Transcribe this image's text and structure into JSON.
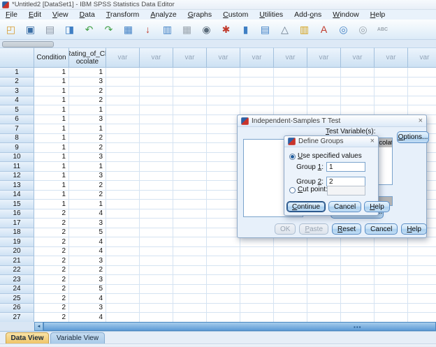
{
  "window": {
    "title": "*Untitled2 [DataSet1] - IBM SPSS Statistics Data Editor"
  },
  "icons": {
    "close_glyph": "×",
    "scroll_left_glyph": "◄",
    "scroll_dots_glyph": "▪▪▪"
  },
  "menubar": {
    "items": [
      {
        "label": "File",
        "u": "F"
      },
      {
        "label": "Edit",
        "u": "E"
      },
      {
        "label": "View",
        "u": "V"
      },
      {
        "label": "Data",
        "u": "D"
      },
      {
        "label": "Transform",
        "u": "T"
      },
      {
        "label": "Analyze",
        "u": "A"
      },
      {
        "label": "Graphs",
        "u": "G"
      },
      {
        "label": "Custom",
        "u": "C"
      },
      {
        "label": "Utilities",
        "u": "U"
      },
      {
        "label": "Add-ons",
        "u": "o"
      },
      {
        "label": "Window",
        "u": "W"
      },
      {
        "label": "Help",
        "u": "H"
      }
    ]
  },
  "toolbar": {
    "icons": [
      {
        "name": "open-data-icon",
        "glyph": "◰",
        "color": "#d79b2f"
      },
      {
        "name": "save-icon",
        "glyph": "▣",
        "color": "#3a6ea5"
      },
      {
        "name": "print-icon",
        "glyph": "▤",
        "color": "#8a94a3"
      },
      {
        "name": "dialog-recall-icon",
        "glyph": "◨",
        "color": "#3f7fc4"
      },
      {
        "name": "undo-icon",
        "glyph": "↶",
        "color": "#43a047"
      },
      {
        "name": "redo-icon",
        "glyph": "↷",
        "color": "#43a047"
      },
      {
        "name": "goto-case-icon",
        "glyph": "▦",
        "color": "#3f7fc4"
      },
      {
        "name": "goto-variable-icon",
        "glyph": "↓",
        "color": "#c0392b"
      },
      {
        "name": "variables-icon",
        "glyph": "▥",
        "color": "#3f7fc4"
      },
      {
        "name": "variables-info-icon",
        "glyph": "▦",
        "color": "#9aa4ad"
      },
      {
        "name": "find-icon",
        "glyph": "◉",
        "color": "#5a6b7a"
      },
      {
        "name": "insert-cases-icon",
        "glyph": "✱",
        "color": "#c0392b"
      },
      {
        "name": "insert-variable-icon",
        "glyph": "▮",
        "color": "#3f7fc4"
      },
      {
        "name": "split-file-icon",
        "glyph": "▤",
        "color": "#3f7fc4"
      },
      {
        "name": "weight-cases-icon",
        "glyph": "△",
        "color": "#6b7c8d"
      },
      {
        "name": "select-cases-icon",
        "glyph": "▥",
        "color": "#d4a017"
      },
      {
        "name": "value-labels-icon",
        "glyph": "A",
        "color": "#c0392b"
      },
      {
        "name": "use-variable-sets-icon",
        "glyph": "◎",
        "color": "#3f7fc4"
      },
      {
        "name": "show-all-cases-icon",
        "glyph": "◎",
        "color": "#9aa4ad"
      },
      {
        "name": "spell-check-icon",
        "glyph": "ABC",
        "color": "#9aa4ad",
        "small": true
      }
    ]
  },
  "grid": {
    "columns": [
      {
        "label": "Condition"
      },
      {
        "label": "Rating_of_Ch\nocolate"
      }
    ],
    "var_label": "var",
    "var_count": 10,
    "rows": [
      [
        1,
        1
      ],
      [
        1,
        3
      ],
      [
        1,
        2
      ],
      [
        1,
        2
      ],
      [
        1,
        1
      ],
      [
        1,
        3
      ],
      [
        1,
        1
      ],
      [
        1,
        2
      ],
      [
        1,
        2
      ],
      [
        1,
        3
      ],
      [
        1,
        1
      ],
      [
        1,
        3
      ],
      [
        1,
        2
      ],
      [
        1,
        2
      ],
      [
        1,
        1
      ],
      [
        2,
        4
      ],
      [
        2,
        3
      ],
      [
        2,
        5
      ],
      [
        2,
        4
      ],
      [
        2,
        4
      ],
      [
        2,
        3
      ],
      [
        2,
        2
      ],
      [
        2,
        3
      ],
      [
        2,
        5
      ],
      [
        2,
        4
      ],
      [
        2,
        3
      ],
      [
        2,
        4
      ]
    ]
  },
  "tabs": {
    "items": [
      {
        "label": "Data View",
        "active": true
      },
      {
        "label": "Variable View",
        "active": false
      }
    ]
  },
  "ttest_dialog": {
    "title": "Independent-Samples T Test",
    "test_variables_label": {
      "label": "Test Variable(s):",
      "u": "T"
    },
    "test_variables": [
      {
        "name": "Rating_of_Chocolate",
        "selected": true
      }
    ],
    "options_button": {
      "label": "Options...",
      "u": "O"
    },
    "define_groups_button": {
      "label": "Define Groups...",
      "u": "D"
    },
    "buttons": [
      {
        "label": "OK",
        "disabled": true
      },
      {
        "label": "Paste",
        "u": "P",
        "disabled": true
      },
      {
        "label": "Reset",
        "u": "R"
      },
      {
        "label": "Cancel"
      },
      {
        "label": "Help",
        "u": "H"
      }
    ]
  },
  "define_groups_dialog": {
    "title": "Define Groups",
    "use_specified_label": {
      "label": "Use specified values",
      "u": "U"
    },
    "group1_label": {
      "label": "Group 1:",
      "u": "1"
    },
    "group1_value": "1",
    "group2_label": {
      "label": "Group 2:",
      "u": "2"
    },
    "group2_value": "2",
    "cut_point_label": {
      "label": "Cut point:",
      "u": "C"
    },
    "cut_point_value": "",
    "buttons": [
      {
        "label": "Continue",
        "u": "C",
        "focused": true
      },
      {
        "label": "Cancel"
      },
      {
        "label": "Help",
        "u": "H"
      }
    ]
  }
}
